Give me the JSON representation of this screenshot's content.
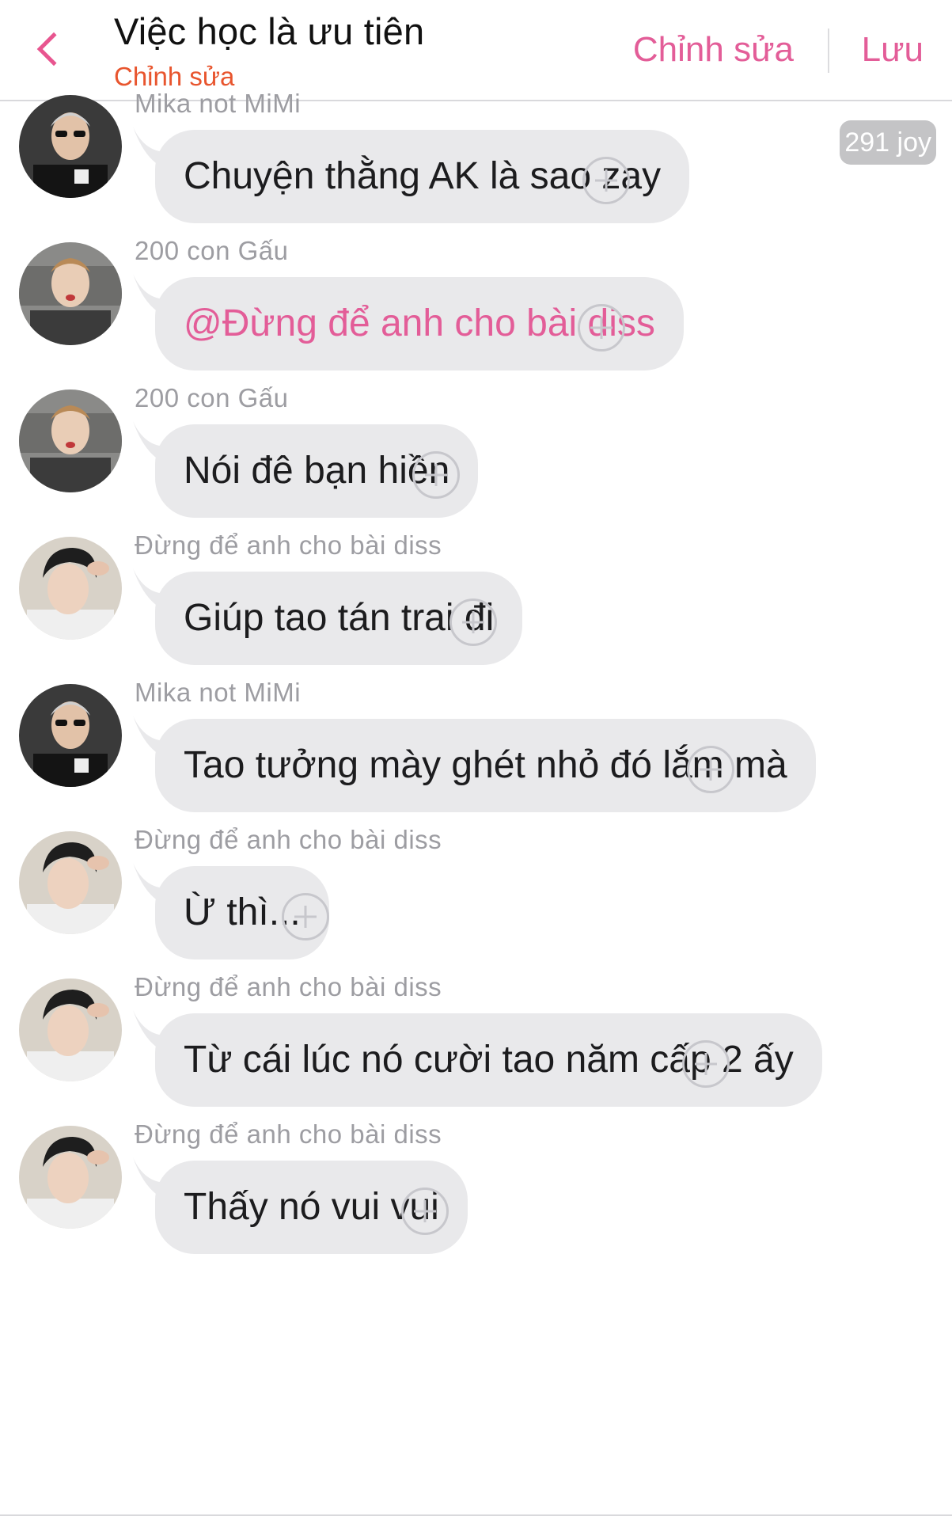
{
  "header": {
    "title": "Việc học là ưu tiên",
    "subtitle": "Chỉnh sửa",
    "edit_label": "Chỉnh sửa",
    "save_label": "Lưu",
    "accent_color": "#e35d98"
  },
  "joy_badge": "291 joy",
  "messages": [
    {
      "sender": "Mika not MiMi",
      "text": "Chuyện thằng AK là sao zay",
      "avatar": "avatar-mika"
    },
    {
      "sender": "200 con Gấu",
      "text": "@Đừng để anh cho bài diss",
      "avatar": "avatar-gau",
      "mention": true
    },
    {
      "sender": "200 con Gấu",
      "text": "Nói đê bạn hiền",
      "avatar": "avatar-gau"
    },
    {
      "sender": "Đừng để anh cho bài diss",
      "text": "Giúp tao tán trai đi",
      "avatar": "avatar-diss"
    },
    {
      "sender": "Mika not MiMi",
      "text": "Tao tưởng mày ghét nhỏ đó lắm mà",
      "avatar": "avatar-mika"
    },
    {
      "sender": "Đừng để anh cho bài diss",
      "text": "Ừ thì...",
      "avatar": "avatar-diss"
    },
    {
      "sender": "Đừng để anh cho bài diss",
      "text": "Từ cái lúc nó cười tao năm cấp 2 ấy",
      "avatar": "avatar-diss"
    },
    {
      "sender": "Đừng để anh cho bài diss",
      "text": "Thấy nó vui vui",
      "avatar": "avatar-diss"
    }
  ]
}
